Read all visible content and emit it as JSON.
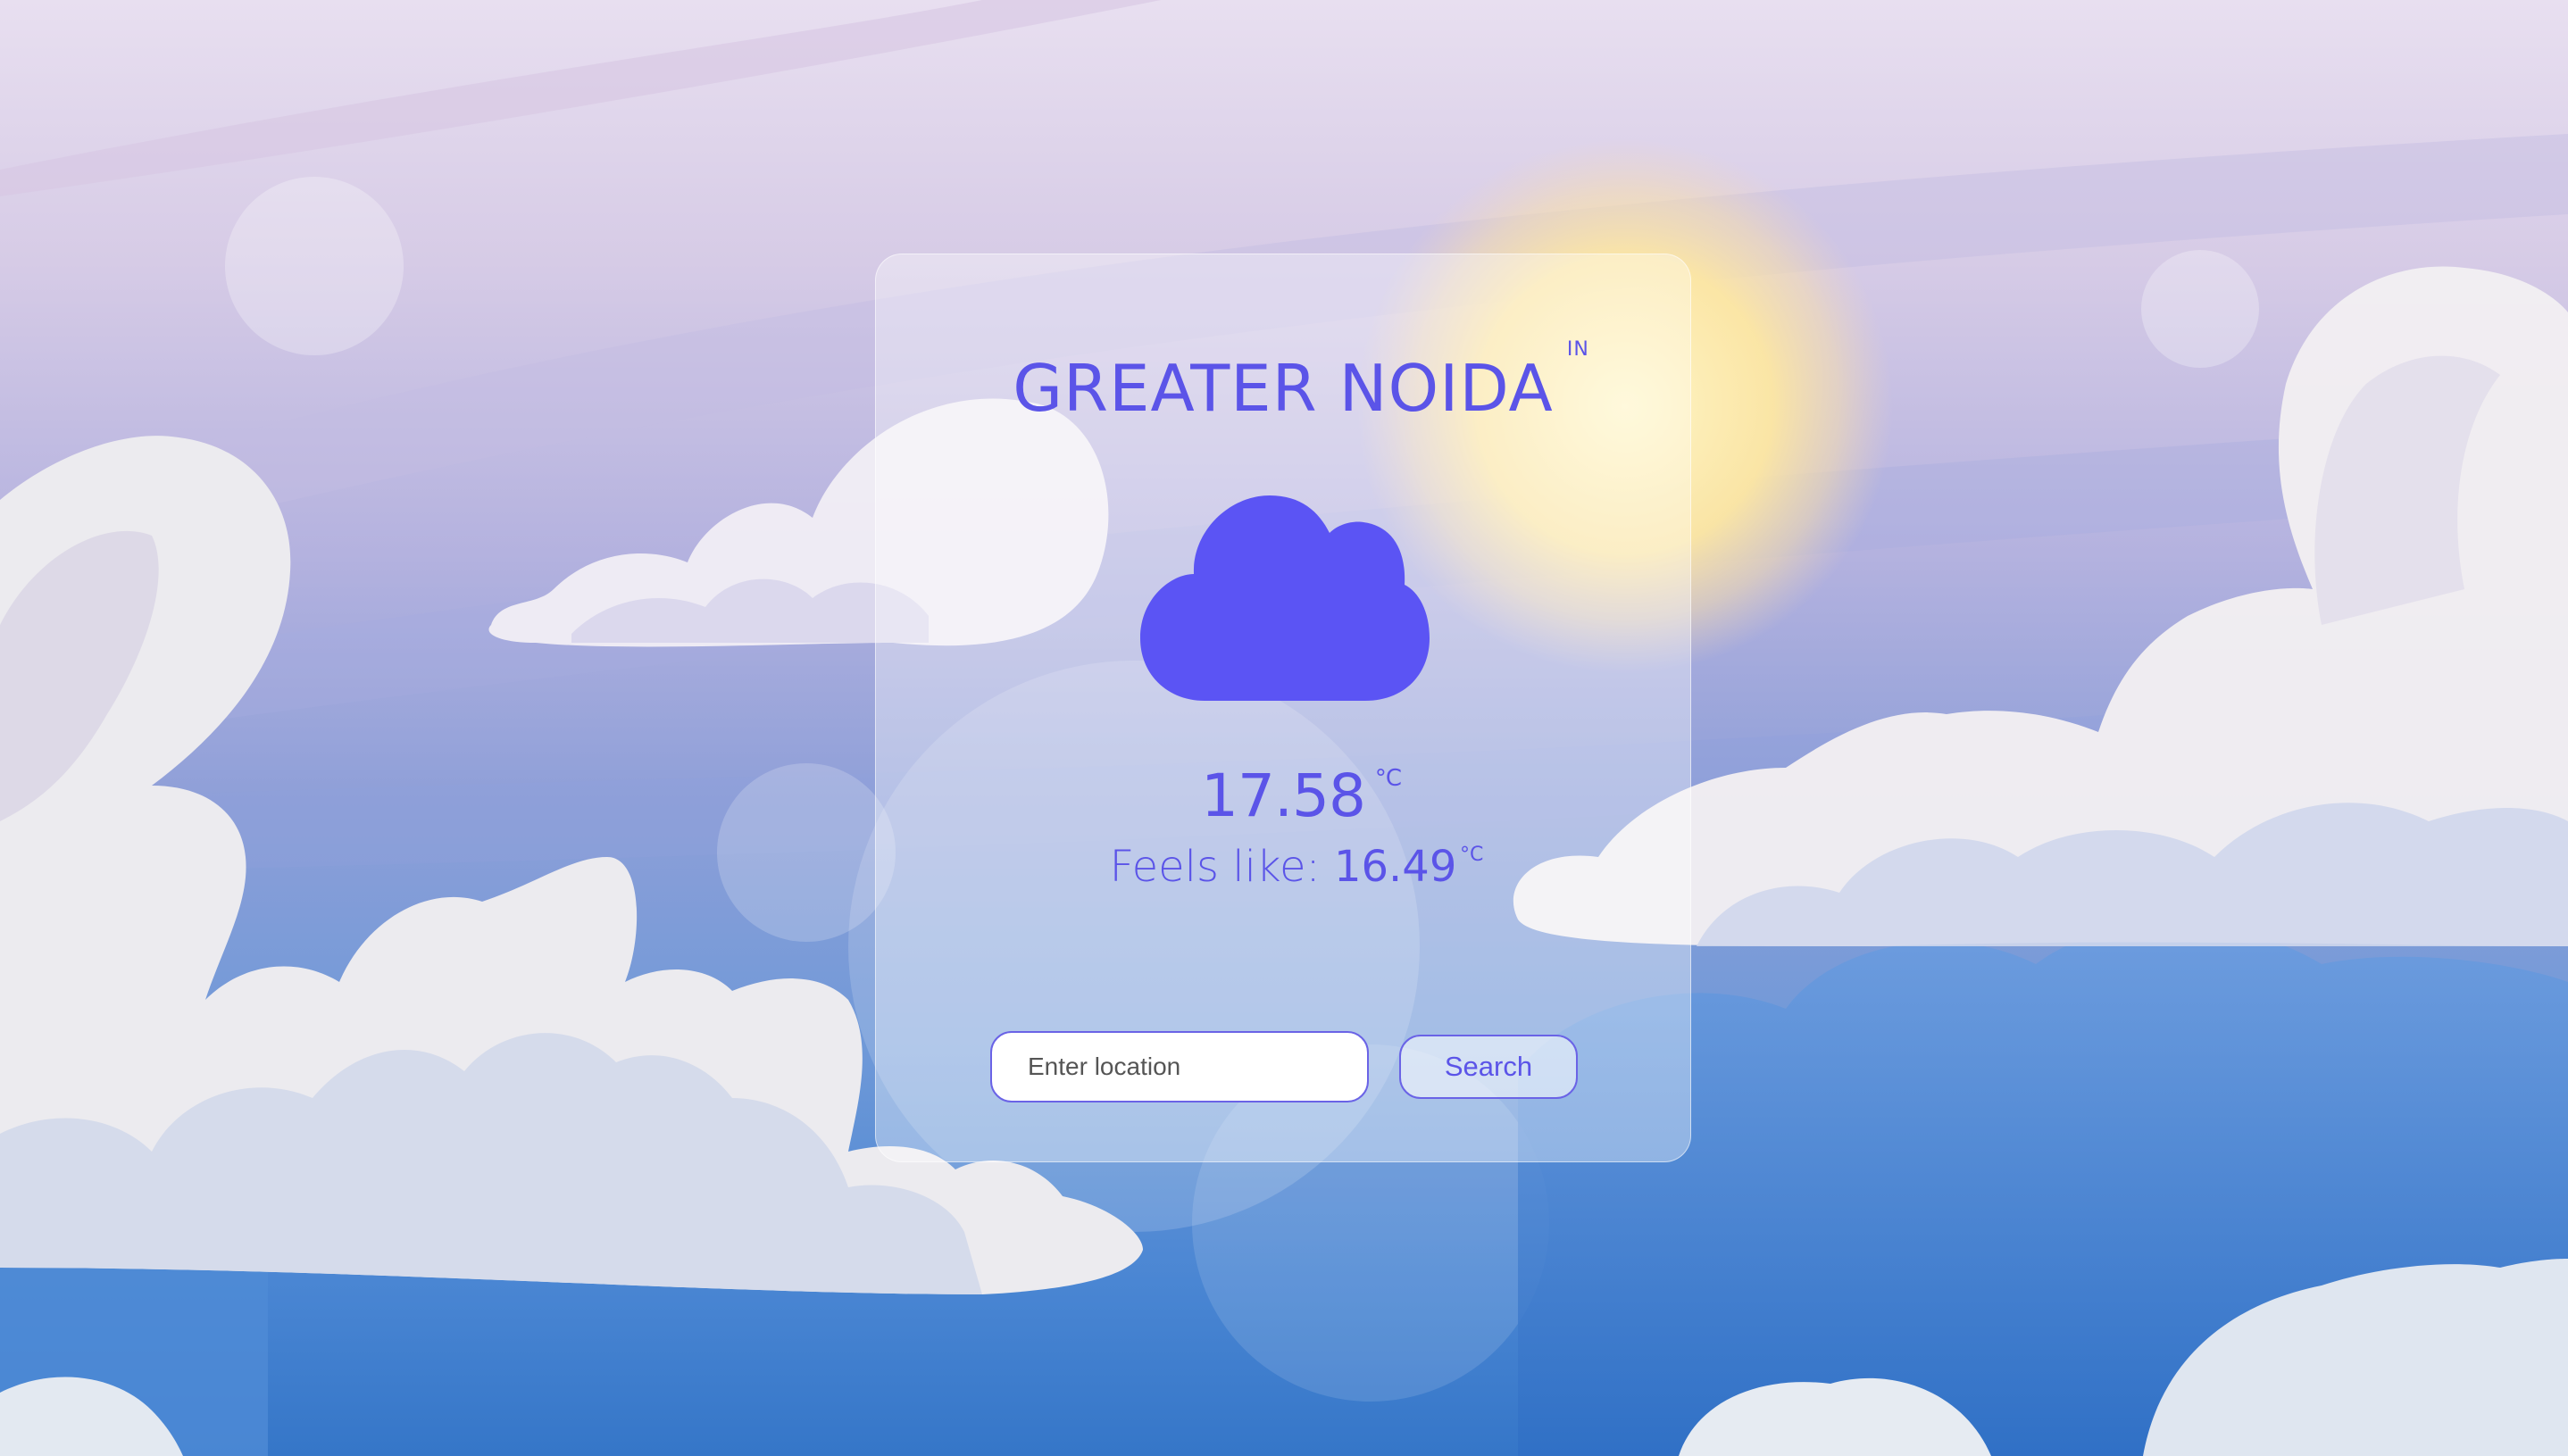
{
  "weather": {
    "city": "GREATER NOIDA",
    "country": "IN",
    "condition_icon": "cloud-icon",
    "temperature": "17.58",
    "temperature_unit": "°C",
    "feels_like_label": "Feels like: ",
    "feels_like": "16.49",
    "feels_like_unit": "°C"
  },
  "search": {
    "placeholder": "Enter location",
    "button_label": "Search"
  },
  "colors": {
    "accent": "#5b54e8",
    "sky_top": "#e6dcee",
    "sky_bottom": "#3a7fd0",
    "sun": "#fde8a0"
  }
}
